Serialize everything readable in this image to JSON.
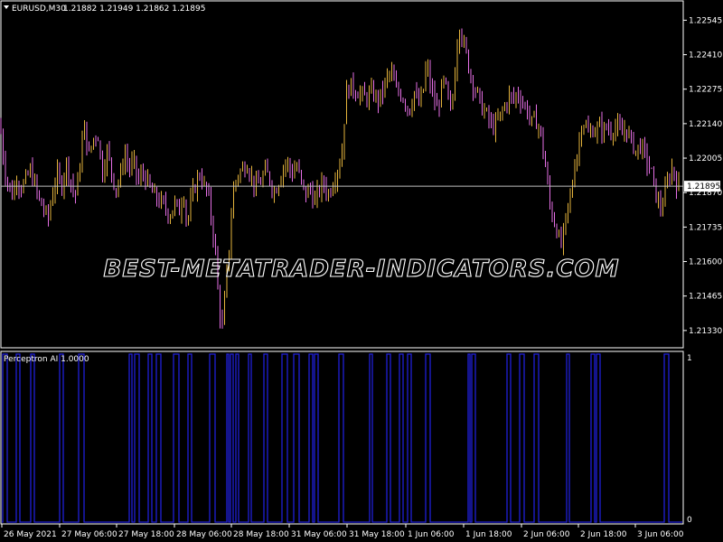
{
  "window": {
    "symbol_label": "EURUSD,M30",
    "ohlc_label": "1.21882 1.21949 1.21862 1.21895",
    "current_price": "1.21895"
  },
  "watermark": "BEST-METATRADER-INDICATORS.COM",
  "indicator": {
    "label": "Perceptron AI 1.0000",
    "ticks": [
      "1",
      "0"
    ]
  },
  "colors": {
    "background": "#000000",
    "frame": "#ffffff",
    "bull": "#e5b43c",
    "bear": "#e66fe6",
    "indicator_line": "#1f1fd8",
    "bid_line": "#c0c0c0"
  },
  "chart_data": [
    {
      "type": "candlestick",
      "symbol": "EURUSD",
      "timeframe": "M30",
      "ylim": [
        1.2128,
        1.2261
      ],
      "y_ticks": [
        "1.22545",
        "1.22410",
        "1.22275",
        "1.22140",
        "1.22005",
        "1.21870",
        "1.21735",
        "1.21600",
        "1.21465",
        "1.21330"
      ],
      "x_ticks": [
        "26 May 2021",
        "27 May 06:00",
        "27 May 18:00",
        "28 May 06:00",
        "28 May 18:00",
        "31 May 06:00",
        "31 May 18:00",
        "1 Jun 06:00",
        "1 Jun 18:00",
        "2 Jun 06:00",
        "2 Jun 18:00",
        "3 Jun 06:00"
      ],
      "close_path": [
        [
          0,
          1.2214
        ],
        [
          5,
          1.2196
        ],
        [
          10,
          1.2189
        ],
        [
          14,
          1.2186
        ],
        [
          18,
          1.2193
        ],
        [
          23,
          1.2189
        ],
        [
          28,
          1.2191
        ],
        [
          33,
          1.2196
        ],
        [
          38,
          1.2191
        ],
        [
          43,
          1.2184
        ],
        [
          48,
          1.2181
        ],
        [
          53,
          1.2176
        ],
        [
          58,
          1.2187
        ],
        [
          63,
          1.2194
        ],
        [
          68,
          1.2189
        ],
        [
          73,
          1.2199
        ],
        [
          78,
          1.2192
        ],
        [
          83,
          1.2185
        ],
        [
          88,
          1.2196
        ],
        [
          93,
          1.2214
        ],
        [
          98,
          1.2201
        ],
        [
          103,
          1.2208
        ],
        [
          108,
          1.2211
        ],
        [
          113,
          1.2194
        ],
        [
          118,
          1.2204
        ],
        [
          123,
          1.2196
        ],
        [
          128,
          1.2188
        ],
        [
          133,
          1.2193
        ],
        [
          138,
          1.2203
        ],
        [
          143,
          1.2196
        ],
        [
          148,
          1.2199
        ],
        [
          153,
          1.2191
        ],
        [
          158,
          1.2195
        ],
        [
          163,
          1.2191
        ],
        [
          168,
          1.2187
        ],
        [
          173,
          1.2185
        ],
        [
          178,
          1.2183
        ],
        [
          183,
          1.2181
        ],
        [
          188,
          1.2178
        ],
        [
          193,
          1.2183
        ],
        [
          198,
          1.2179
        ],
        [
          203,
          1.2188
        ],
        [
          207,
          1.2174
        ],
        [
          212,
          1.2185
        ],
        [
          217,
          1.2191
        ],
        [
          222,
          1.2195
        ],
        [
          226,
          1.2189
        ],
        [
          230,
          1.2187
        ],
        [
          234,
          1.2176
        ],
        [
          238,
          1.2166
        ],
        [
          242,
          1.2143
        ],
        [
          246,
          1.2134
        ],
        [
          250,
          1.2151
        ],
        [
          254,
          1.2168
        ],
        [
          258,
          1.2188
        ],
        [
          263,
          1.2194
        ],
        [
          268,
          1.2196
        ],
        [
          273,
          1.2199
        ],
        [
          278,
          1.2193
        ],
        [
          283,
          1.2189
        ],
        [
          288,
          1.2191
        ],
        [
          293,
          1.2195
        ],
        [
          298,
          1.2193
        ],
        [
          303,
          1.2187
        ],
        [
          308,
          1.2191
        ],
        [
          313,
          1.2197
        ],
        [
          318,
          1.2199
        ],
        [
          323,
          1.2194
        ],
        [
          328,
          1.2198
        ],
        [
          333,
          1.2191
        ],
        [
          338,
          1.2186
        ],
        [
          343,
          1.2189
        ],
        [
          348,
          1.2183
        ],
        [
          353,
          1.2188
        ],
        [
          358,
          1.2191
        ],
        [
          363,
          1.2186
        ],
        [
          368,
          1.2191
        ],
        [
          373,
          1.2196
        ],
        [
          378,
          1.2201
        ],
        [
          383,
          1.2226
        ],
        [
          388,
          1.2229
        ],
        [
          393,
          1.2227
        ],
        [
          398,
          1.2226
        ],
        [
          403,
          1.2224
        ],
        [
          408,
          1.2225
        ],
        [
          413,
          1.2226
        ],
        [
          418,
          1.2223
        ],
        [
          423,
          1.2226
        ],
        [
          428,
          1.2232
        ],
        [
          433,
          1.2234
        ],
        [
          438,
          1.2227
        ],
        [
          443,
          1.2226
        ],
        [
          448,
          1.2223
        ],
        [
          453,
          1.2219
        ],
        [
          458,
          1.2227
        ],
        [
          463,
          1.2221
        ],
        [
          468,
          1.2226
        ],
        [
          472,
          1.2238
        ],
        [
          476,
          1.2229
        ],
        [
          480,
          1.2224
        ],
        [
          484,
          1.2219
        ],
        [
          488,
          1.2227
        ],
        [
          492,
          1.2231
        ],
        [
          496,
          1.2222
        ],
        [
          500,
          1.2219
        ],
        [
          504,
          1.2238
        ],
        [
          508,
          1.2254
        ],
        [
          512,
          1.2246
        ],
        [
          516,
          1.2241
        ],
        [
          520,
          1.2234
        ],
        [
          524,
          1.2229
        ],
        [
          528,
          1.2226
        ],
        [
          532,
          1.2221
        ],
        [
          536,
          1.2219
        ],
        [
          540,
          1.2216
        ],
        [
          544,
          1.2213
        ],
        [
          548,
          1.2213
        ],
        [
          552,
          1.2216
        ],
        [
          556,
          1.2219
        ],
        [
          560,
          1.2222
        ],
        [
          564,
          1.2225
        ],
        [
          568,
          1.2223
        ],
        [
          572,
          1.2226
        ],
        [
          576,
          1.2224
        ],
        [
          580,
          1.2221
        ],
        [
          584,
          1.2219
        ],
        [
          588,
          1.2214
        ],
        [
          592,
          1.2216
        ],
        [
          596,
          1.2213
        ],
        [
          600,
          1.2206
        ],
        [
          604,
          1.2196
        ],
        [
          608,
          1.2183
        ],
        [
          612,
          1.2177
        ],
        [
          616,
          1.2173
        ],
        [
          620,
          1.2165
        ],
        [
          624,
          1.2171
        ],
        [
          628,
          1.2181
        ],
        [
          632,
          1.2186
        ],
        [
          636,
          1.2199
        ],
        [
          640,
          1.2204
        ],
        [
          644,
          1.2216
        ],
        [
          648,
          1.2213
        ],
        [
          652,
          1.2209
        ],
        [
          656,
          1.2212
        ],
        [
          660,
          1.2211
        ],
        [
          664,
          1.2213
        ],
        [
          668,
          1.2211
        ],
        [
          672,
          1.2213
        ],
        [
          676,
          1.2211
        ],
        [
          680,
          1.2213
        ],
        [
          684,
          1.2212
        ],
        [
          688,
          1.2209
        ],
        [
          692,
          1.2213
        ],
        [
          696,
          1.2209
        ],
        [
          700,
          1.2206
        ],
        [
          704,
          1.2203
        ],
        [
          708,
          1.2206
        ],
        [
          712,
          1.2203
        ],
        [
          716,
          1.2199
        ],
        [
          720,
          1.2196
        ],
        [
          724,
          1.2189
        ],
        [
          728,
          1.2183
        ],
        [
          732,
          1.2181
        ],
        [
          736,
          1.2187
        ],
        [
          740,
          1.2193
        ],
        [
          744,
          1.2197
        ],
        [
          748,
          1.2191
        ],
        [
          752,
          1.2189
        ]
      ]
    },
    {
      "type": "line",
      "series_label": "Perceptron AI 1.0000",
      "ylim": [
        0,
        1
      ],
      "signal_highs": [
        [
          3,
          8
        ],
        [
          18,
          22
        ],
        [
          34,
          38
        ],
        [
          66,
          70
        ],
        [
          87,
          93
        ],
        [
          143,
          146
        ],
        [
          149,
          154
        ],
        [
          164,
          168
        ],
        [
          173,
          178
        ],
        [
          192,
          198
        ],
        [
          208,
          212
        ],
        [
          232,
          238
        ],
        [
          251,
          253
        ],
        [
          255,
          258
        ],
        [
          261,
          264
        ],
        [
          275,
          278
        ],
        [
          292,
          296
        ],
        [
          312,
          318
        ],
        [
          325,
          331
        ],
        [
          342,
          346
        ],
        [
          348,
          352
        ],
        [
          375,
          380
        ],
        [
          409,
          412
        ],
        [
          428,
          432
        ],
        [
          442,
          446
        ],
        [
          451,
          455
        ],
        [
          471,
          476
        ],
        [
          518,
          520
        ],
        [
          522,
          526
        ],
        [
          561,
          565
        ],
        [
          575,
          580
        ],
        [
          591,
          596
        ],
        [
          627,
          630
        ],
        [
          654,
          658
        ],
        [
          660,
          664
        ],
        [
          735,
          740
        ]
      ]
    }
  ]
}
